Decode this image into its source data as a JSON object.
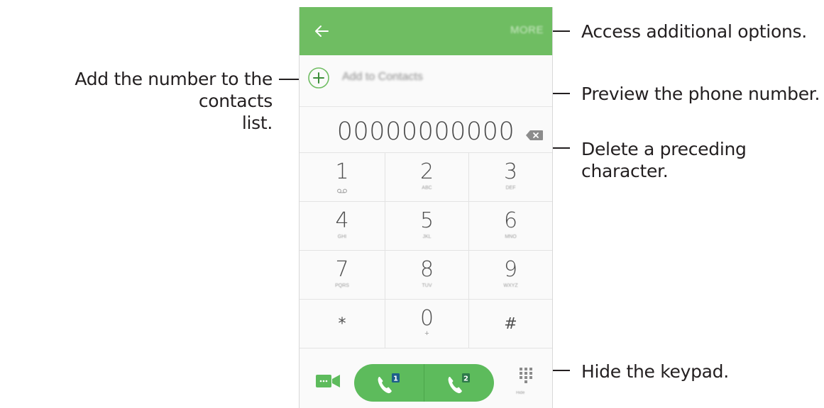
{
  "phone": {
    "appbar": {
      "more_label": "MORE"
    },
    "add_to_contacts": {
      "label": "Add to Contacts"
    },
    "number_preview": "00000000000",
    "keys": [
      {
        "digit": "1",
        "sub": ""
      },
      {
        "digit": "2",
        "sub": "ABC"
      },
      {
        "digit": "3",
        "sub": "DEF"
      },
      {
        "digit": "4",
        "sub": "GHI"
      },
      {
        "digit": "5",
        "sub": "JKL"
      },
      {
        "digit": "6",
        "sub": "MNO"
      },
      {
        "digit": "7",
        "sub": "PQRS"
      },
      {
        "digit": "8",
        "sub": "TUV"
      },
      {
        "digit": "9",
        "sub": "WXYZ"
      },
      {
        "digit": "*",
        "sub": ""
      },
      {
        "digit": "0",
        "sub": "+"
      },
      {
        "digit": "#",
        "sub": ""
      }
    ],
    "sim1_badge": "1",
    "sim2_badge": "2",
    "hide_label": "Hide"
  },
  "callouts": {
    "more_options": "Access additional options.",
    "add_contacts_line1": "Add the number to the contacts",
    "add_contacts_line2": "list.",
    "preview_number": "Preview the phone number.",
    "delete_char": "Delete a preceding character.",
    "hide_keypad": "Hide the keypad."
  },
  "colors": {
    "appbar": "#6fbd62",
    "call_button": "#5dbb5c",
    "background": "#fafafa"
  }
}
